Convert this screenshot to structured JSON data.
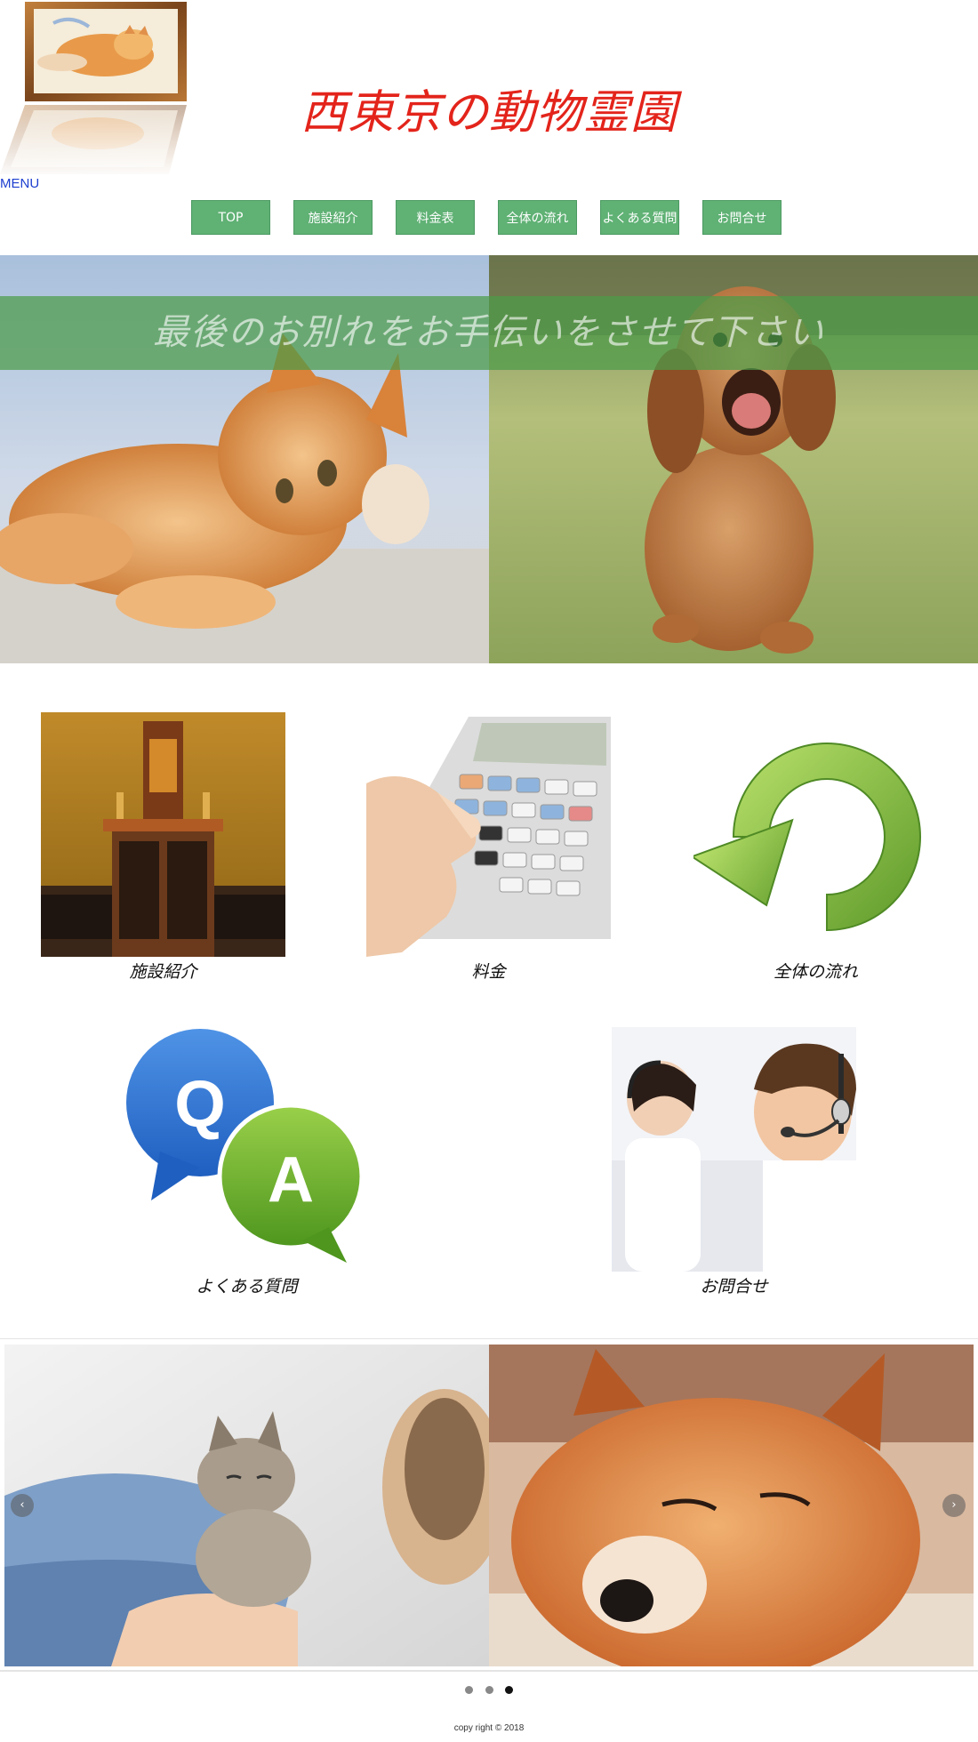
{
  "header": {
    "site_title": "西東京の動物霊園",
    "menu_label": "MENU"
  },
  "nav": {
    "items": [
      {
        "label": "TOP"
      },
      {
        "label": "施設紹介"
      },
      {
        "label": "料金表"
      },
      {
        "label": "全体の流れ"
      },
      {
        "label": "よくある質問"
      },
      {
        "label": "お問合せ"
      }
    ]
  },
  "hero": {
    "tagline": "最後のお別れをお手伝いをさせて下さい"
  },
  "services": [
    {
      "label": "施設紹介",
      "icon": "altar-photo"
    },
    {
      "label": "料金",
      "icon": "calculator-photo"
    },
    {
      "label": "全体の流れ",
      "icon": "cycle-arrow-icon"
    },
    {
      "label": "よくある質問",
      "icon": "qa-bubbles-icon"
    },
    {
      "label": "お問合せ",
      "icon": "call-center-photo"
    }
  ],
  "slider": {
    "prev_label": "‹",
    "next_label": "›",
    "dot_count": 3,
    "active_dot": 3
  },
  "footer": {
    "copyright": "copy right © 2018"
  },
  "colors": {
    "title": "#e3241b",
    "nav_button": "#5fb174",
    "menu_link": "#1d3fcf",
    "hero_banner": "#4c9b48"
  }
}
